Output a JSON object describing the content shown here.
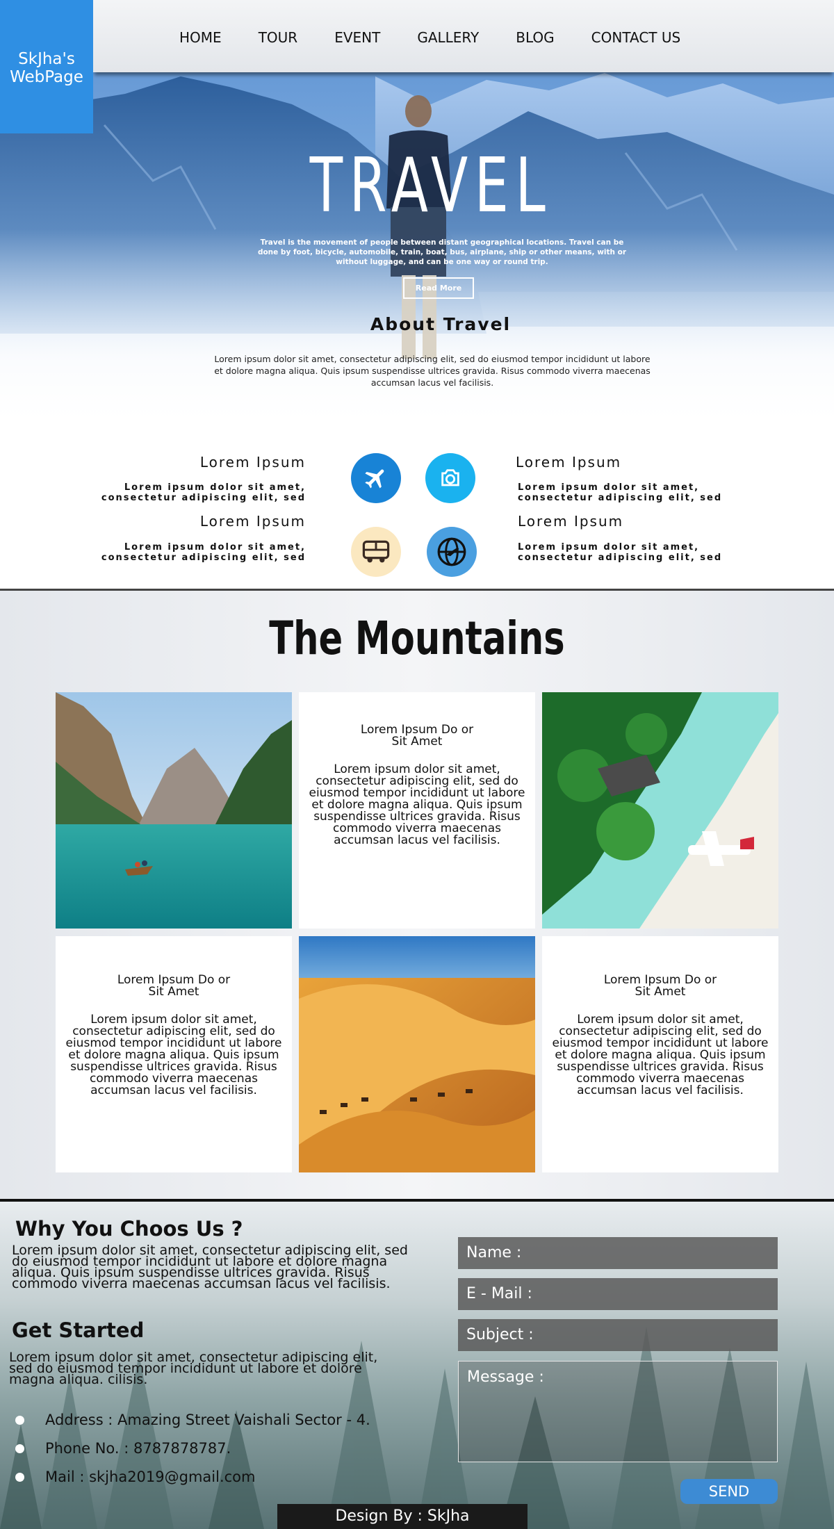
{
  "brand": {
    "logo_line1": "SkJha's",
    "logo_line2": "WebPage"
  },
  "nav": {
    "items": [
      "HOME",
      "TOUR",
      "EVENT",
      "GALLERY",
      "BLOG",
      "CONTACT US"
    ]
  },
  "hero": {
    "title": "TRAVEL",
    "description": "Travel is the movement of people between distant geographical locations. Travel can be done by foot, bicycle, automobile, train, boat, bus, airplane, ship or other means, with or without luggage, and can be one way or round trip.",
    "cta_label": "Read More"
  },
  "about": {
    "title": "About Travel",
    "text": "Lorem ipsum dolor sit amet, consectetur adipiscing elit, sed do eiusmod tempor incididunt ut labore et dolore magna aliqua. Quis ipsum suspendisse ultrices gravida. Risus commodo viverra maecenas accumsan lacus vel facilisis."
  },
  "features": [
    {
      "title": "Lorem Ipsum",
      "text": "Lorem ipsum dolor sit amet, consectetur adipiscing elit, sed",
      "icon": "airplane-icon",
      "color": "#1883d6"
    },
    {
      "title": "Lorem Ipsum",
      "text": "Lorem ipsum dolor sit amet, consectetur adipiscing elit, sed",
      "icon": "camera-icon",
      "color": "#1ab2ef"
    },
    {
      "title": "Lorem Ipsum",
      "text": "Lorem ipsum dolor sit amet, consectetur adipiscing elit, sed",
      "icon": "bus-icon",
      "color": "#fbe8c0"
    },
    {
      "title": "Lorem Ipsum",
      "text": "Lorem ipsum dolor sit amet, consectetur adipiscing elit, sed",
      "icon": "globe-icon",
      "color": "#4a9fe0"
    }
  ],
  "mountains": {
    "title": "The Mountains",
    "cards": [
      {
        "heading_line1": "Lorem Ipsum Do or",
        "heading_line2": "Sit Amet",
        "text": "Lorem ipsum dolor sit amet, consectetur adipiscing elit, sed do eiusmod tempor incididunt ut labore et dolore magna aliqua. Quis ipsum suspendisse ultrices gravida. Risus commodo viverra maecenas accumsan lacus vel facilisis."
      },
      {
        "heading_line1": "Lorem Ipsum Do or",
        "heading_line2": "Sit Amet",
        "text": "Lorem ipsum dolor sit amet, consectetur adipiscing elit, sed do eiusmod tempor incididunt ut labore et dolore magna aliqua. Quis ipsum suspendisse ultrices gravida. Risus commodo viverra maecenas accumsan lacus vel facilisis."
      },
      {
        "heading_line1": "Lorem Ipsum Do or",
        "heading_line2": "Sit Amet",
        "text": "Lorem ipsum dolor sit amet, consectetur adipiscing elit, sed do eiusmod tempor incididunt ut labore et dolore magna aliqua. Quis ipsum suspendisse ultrices gravida. Risus commodo viverra maecenas accumsan lacus vel facilisis."
      }
    ],
    "photos": [
      "lake-boat-photo",
      "tropical-beach-photo",
      "desert-caravan-photo"
    ]
  },
  "contact": {
    "why_title": "Why You Choos Us ?",
    "why_text": "Lorem ipsum dolor sit amet, consectetur adipiscing elit, sed do eiusmod tempor incididunt ut labore et dolore magna aliqua. Quis ipsum suspendisse ultrices gravida. Risus commodo viverra maecenas accumsan lacus vel facilisis.",
    "get_started_title": "Get Started",
    "get_started_text": "Lorem ipsum dolor sit amet, consectetur adipiscing elit, sed do eiusmod tempor incididunt ut labore et dolore magna aliqua. cilisis.",
    "info": [
      "Address : Amazing Street Vaishali Sector - 4.",
      "Phone No. : 8787878787.",
      "Mail : skjha2019@gmail.com"
    ],
    "form": {
      "name_label": "Name :",
      "email_label": "E - Mail :",
      "subject_label": "Subject :",
      "message_label": "Message :",
      "send_label": "SEND"
    },
    "credit": "Design By : SkJha"
  }
}
